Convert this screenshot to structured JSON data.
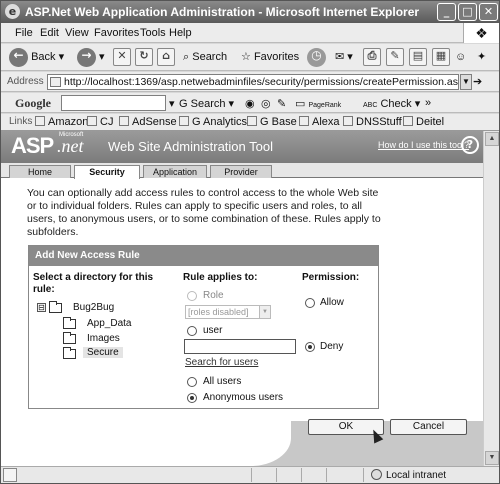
{
  "window": {
    "title": "ASP.Net Web Application Administration - Microsoft Internet Explorer"
  },
  "menu": [
    "File",
    "Edit",
    "View",
    "Favorites",
    "Tools",
    "Help"
  ],
  "toolbar": {
    "back": "Back",
    "search": "Search",
    "favorites": "Favorites"
  },
  "address": {
    "label": "Address",
    "url": "http://localhost:1369/asp.netwebadminfiles/security/permissions/createPermission.aspx",
    "go": "Go"
  },
  "google": {
    "logo": "Google",
    "search": "Search",
    "pagerank": "PageRank",
    "check": "Check",
    "more": "»"
  },
  "links": {
    "label": "Links",
    "items": [
      "Amazon",
      "CJ",
      "AdSense",
      "G Analytics",
      "G Base",
      "Alexa",
      "DNSStuff",
      "Deitel"
    ]
  },
  "header": {
    "asp": "ASP",
    "microsoft": "Microsoft",
    "net": ".net",
    "tool": "Web Site Administration Tool",
    "help": "How do I use this tool?",
    "help_icon": "?"
  },
  "tabs": [
    "Home",
    "Security",
    "Application",
    "Provider"
  ],
  "intro": "You can optionally add access rules to control access to the whole Web site or to individual folders. Rules can apply to specific users and roles, to all users, to anonymous users, or to some combination of these. Rules apply to subfolders.",
  "rule": {
    "title": "Add New Access Rule",
    "dir_header": "Select a directory for this rule:",
    "tree": {
      "expander": "⊟",
      "root": "Bug2Bug",
      "children": [
        "App_Data",
        "Images",
        "Secure"
      ]
    },
    "applies_header": "Rule applies to:",
    "role_label": "Role",
    "role_select": "[roles disabled]",
    "user_label": "user",
    "search_users": "Search for users",
    "all_users": "All users",
    "anonymous_users": "Anonymous users",
    "perm_header": "Permission:",
    "allow": "Allow",
    "deny": "Deny"
  },
  "buttons": {
    "ok": "OK",
    "cancel": "Cancel"
  },
  "status": {
    "zone": "Local intranet"
  }
}
